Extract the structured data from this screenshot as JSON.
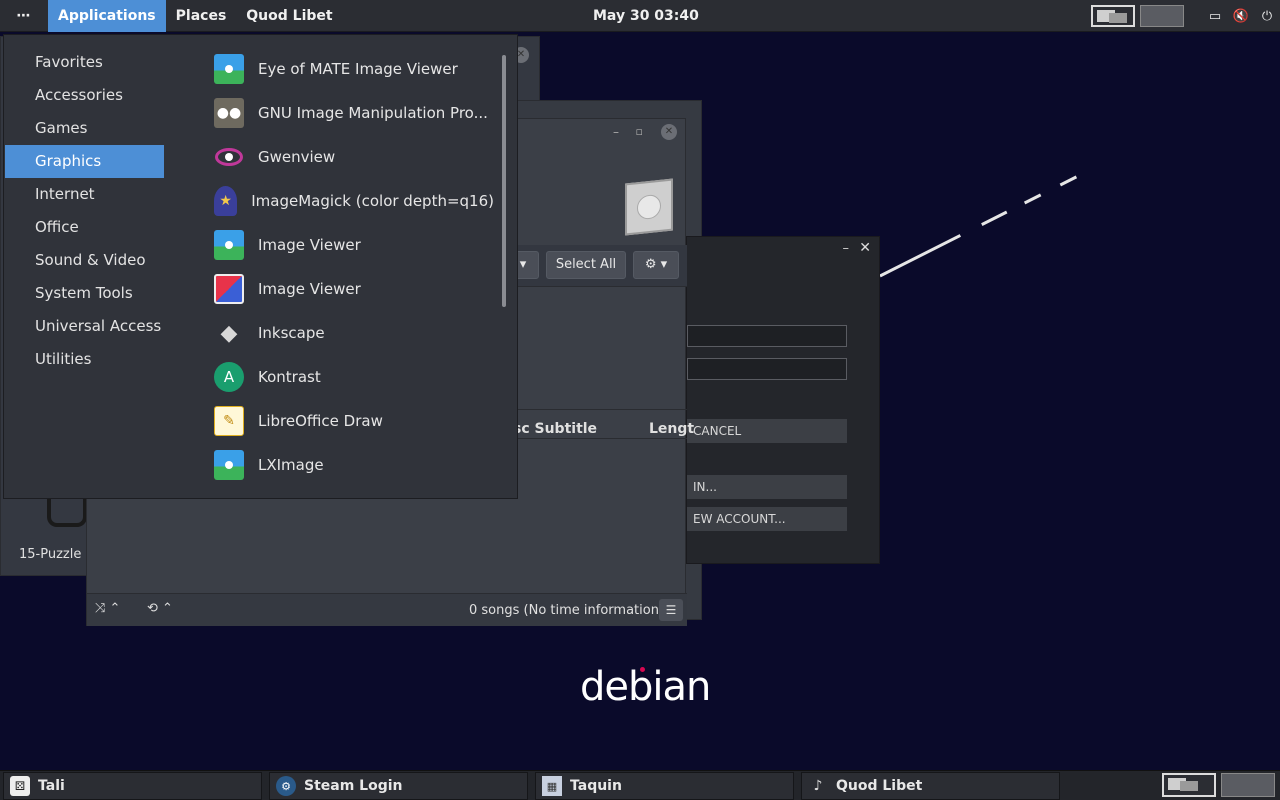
{
  "top_panel": {
    "dots": "⋯",
    "applications": "Applications",
    "places": "Places",
    "active_app": "Quod Libet",
    "clock": "May 30  03:40"
  },
  "menu": {
    "categories": [
      "Favorites",
      "Accessories",
      "Games",
      "Graphics",
      "Internet",
      "Office",
      "Sound & Video",
      "System Tools",
      "Universal Access",
      "Utilities"
    ],
    "selected_category": "Graphics",
    "apps": [
      "Eye of MATE Image Viewer",
      "GNU Image Manipulation Pro...",
      "Gwenview",
      "ImageMagick (color depth=q16)",
      "Image Viewer",
      "Image Viewer",
      "Inkscape",
      "Kontrast",
      "LibreOffice Draw",
      "LXImage"
    ]
  },
  "puzzle_window": {
    "title": "15-Puzzle"
  },
  "quod_libet": {
    "select_all": "Select All",
    "col_disc_subtitle": "sc Subtitle",
    "col_length": "Lengt",
    "status": "0 songs (No time information)"
  },
  "steam_login": {
    "cancel": "CANCEL",
    "login": "IN...",
    "new_account": "EW ACCOUNT..."
  },
  "desktop": {
    "logo": "debian"
  },
  "taskbar": [
    "Tali",
    "Steam Login",
    "Taquin",
    "Quod Libet"
  ],
  "colors": {
    "accent": "#4d8fd6",
    "panel": "#2b2d33",
    "desktop": "#0a0a2a"
  }
}
